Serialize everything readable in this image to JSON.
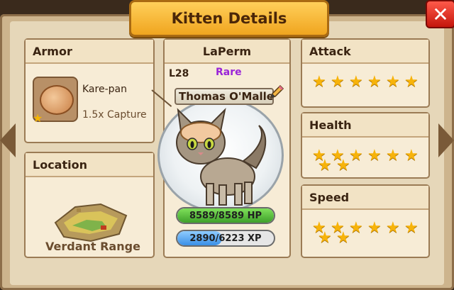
{
  "title": "Kitten Details",
  "close_label": "✕",
  "armor": {
    "header": "Armor",
    "item_name": "Kare-pan",
    "item_effect": "1.5x Capture"
  },
  "location": {
    "header": "Location",
    "name": "Verdant Range"
  },
  "cat": {
    "breed": "LaPerm",
    "level": "L28",
    "rarity": "Rare",
    "name": "Thomas O'Malle",
    "hp_text": "8589/8589 HP",
    "hp_fraction": 1.0,
    "xp_text": "2890/6223 XP",
    "xp_fraction": 0.464
  },
  "stats": {
    "attack": {
      "label": "Attack",
      "stars": 6
    },
    "health": {
      "label": "Health",
      "stars": 8
    },
    "speed": {
      "label": "Speed",
      "stars": 8
    }
  },
  "colors": {
    "rarity": "#9a24d8",
    "star": "#f7b30a",
    "hp": "#3ea02a",
    "xp": "#3a8fe6"
  }
}
